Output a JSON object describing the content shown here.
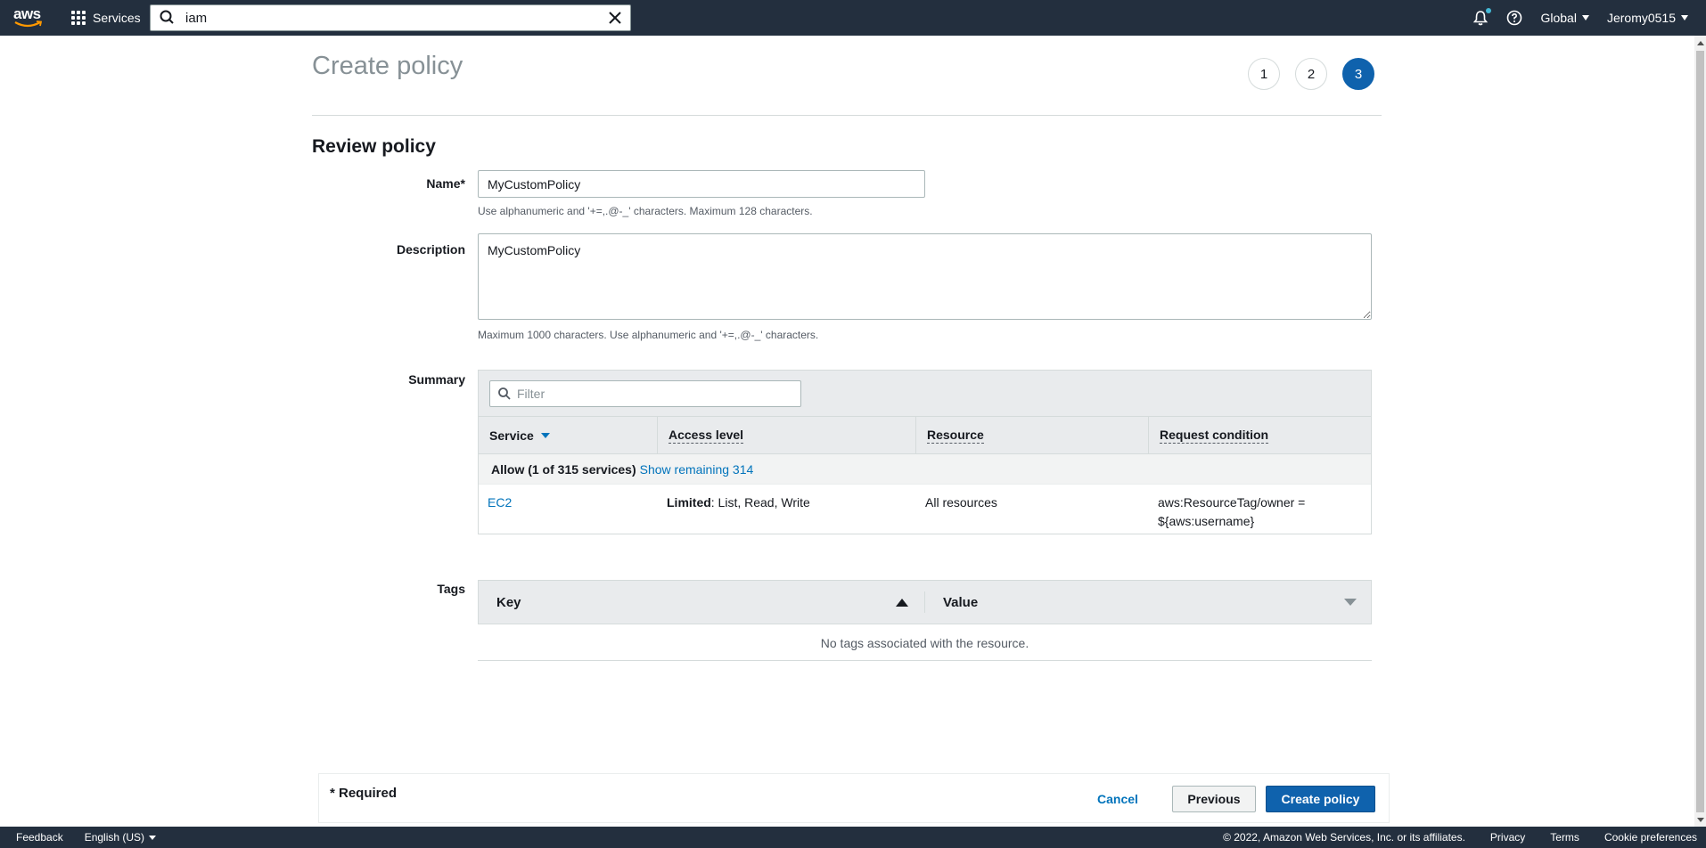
{
  "topnav": {
    "logo_text": "aws",
    "services_label": "Services",
    "search_value": "iam",
    "region_label": "Global",
    "account_label": "Jeromy0515"
  },
  "page": {
    "title": "Create policy",
    "steps": [
      "1",
      "2",
      "3"
    ],
    "active_step": 3,
    "section_title": "Review policy"
  },
  "form": {
    "name_label": "Name*",
    "name_value": "MyCustomPolicy",
    "name_hint": "Use alphanumeric and '+=,.@-_' characters. Maximum 128 characters.",
    "description_label": "Description",
    "description_value": "MyCustomPolicy",
    "description_hint": "Maximum 1000 characters. Use alphanumeric and '+=,.@-_' characters.",
    "summary_label": "Summary",
    "tags_label": "Tags"
  },
  "summary": {
    "filter_placeholder": "Filter",
    "columns": [
      "Service",
      "Access level",
      "Resource",
      "Request condition"
    ],
    "group_label": "Allow (1 of 315 services)",
    "group_link": "Show remaining 314",
    "rows": [
      {
        "service": "EC2",
        "access_level_bold": "Limited",
        "access_level_rest": ": List, Read, Write",
        "resource": "All resources",
        "request_condition_line1": "aws:ResourceTag/owner =",
        "request_condition_line2": "${aws:username}"
      }
    ]
  },
  "tags": {
    "columns": [
      "Key",
      "Value"
    ],
    "empty_message": "No tags associated with the resource."
  },
  "actions": {
    "required_note": "* Required",
    "cancel": "Cancel",
    "previous": "Previous",
    "create": "Create policy"
  },
  "footer": {
    "feedback": "Feedback",
    "language": "English (US)",
    "copyright": "© 2022, Amazon Web Services, Inc. or its affiliates.",
    "privacy": "Privacy",
    "terms": "Terms",
    "cookie_preferences": "Cookie preferences"
  },
  "colors": {
    "nav_background": "#232f3e",
    "primary_button": "#0f62ad",
    "link": "#0073bb",
    "table_header": "#e9ebed"
  }
}
